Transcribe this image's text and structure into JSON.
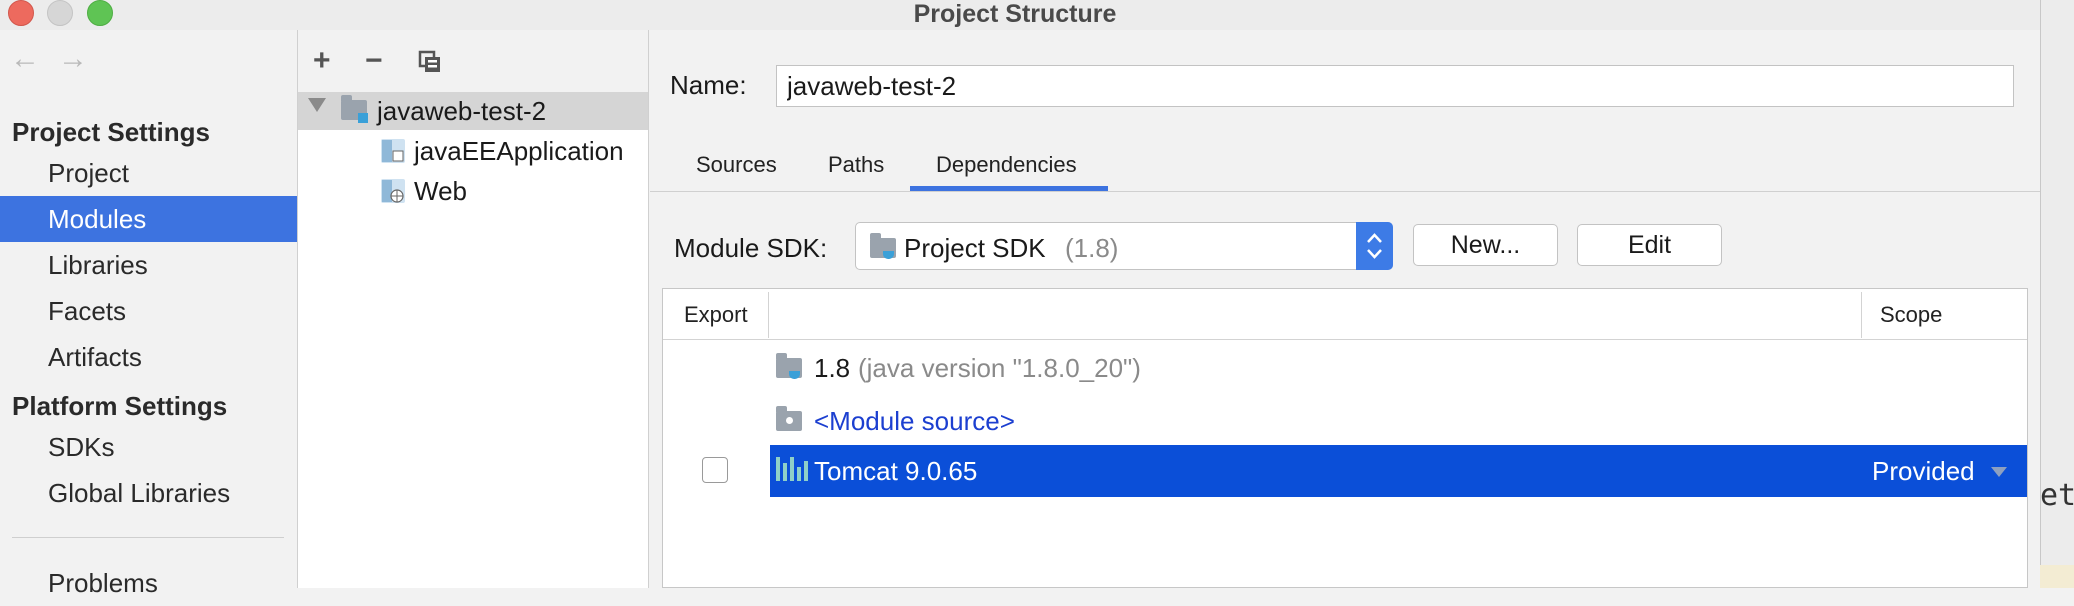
{
  "window": {
    "title": "Project Structure"
  },
  "nav": {
    "back": "←",
    "forward": "→",
    "project_settings_heading": "Project Settings",
    "project_items": [
      "Project",
      "Modules",
      "Libraries",
      "Facets",
      "Artifacts"
    ],
    "selected": "Modules",
    "platform_settings_heading": "Platform Settings",
    "platform_items": [
      "SDKs",
      "Global Libraries"
    ],
    "problems": "Problems"
  },
  "tree": {
    "toolbar": {
      "add": "+",
      "remove": "−"
    },
    "root": "javaweb-test-2",
    "children": [
      "javaEEApplication",
      "Web"
    ]
  },
  "main": {
    "name_label": "Name:",
    "name_value": "javaweb-test-2",
    "tabs": [
      "Sources",
      "Paths",
      "Dependencies"
    ],
    "active_tab": "Dependencies",
    "sdk_label": "Module SDK:",
    "sdk_value": "Project SDK",
    "sdk_version": "(1.8)",
    "new_button": "New...",
    "edit_button": "Edit",
    "table": {
      "columns": [
        "Export",
        "Scope"
      ],
      "rows": [
        {
          "name": "1.8",
          "detail": "(java version \"1.8.0_20\")",
          "scope": ""
        },
        {
          "name": "<Module source>",
          "scope": ""
        },
        {
          "name": "Tomcat 9.0.65",
          "scope": "Provided",
          "exported": false,
          "selected": true
        }
      ]
    }
  },
  "outside": {
    "text": "et"
  },
  "colors": {
    "accent": "#3d73e0",
    "selection": "#0b4fd8",
    "link": "#1c3fd0"
  }
}
